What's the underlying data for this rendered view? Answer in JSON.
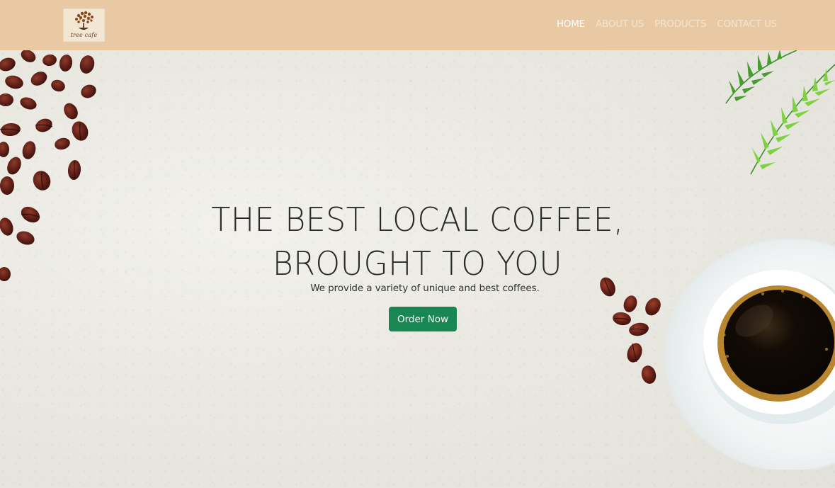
{
  "brand": {
    "logo_text": "tree cafe",
    "logo_icon": "coffee-tree-icon"
  },
  "nav": {
    "items": [
      {
        "label": "HOME",
        "active": true
      },
      {
        "label": "ABOUT US",
        "active": false
      },
      {
        "label": "PRODUCTS",
        "active": false
      },
      {
        "label": "CONTACT US",
        "active": false
      }
    ]
  },
  "hero": {
    "title_line1": "THE BEST LOCAL COFFEE,",
    "title_line2": "BROUGHT TO YOU",
    "subtitle": "We provide a variety of unique and best coffees.",
    "cta_label": "Order Now"
  },
  "colors": {
    "navbar": "#e8c9a3",
    "cta": "#198754",
    "background": "#e9e8e2"
  },
  "decorations": [
    "coffee-beans-image",
    "fern-leaves-image",
    "coffee-cup-image"
  ]
}
